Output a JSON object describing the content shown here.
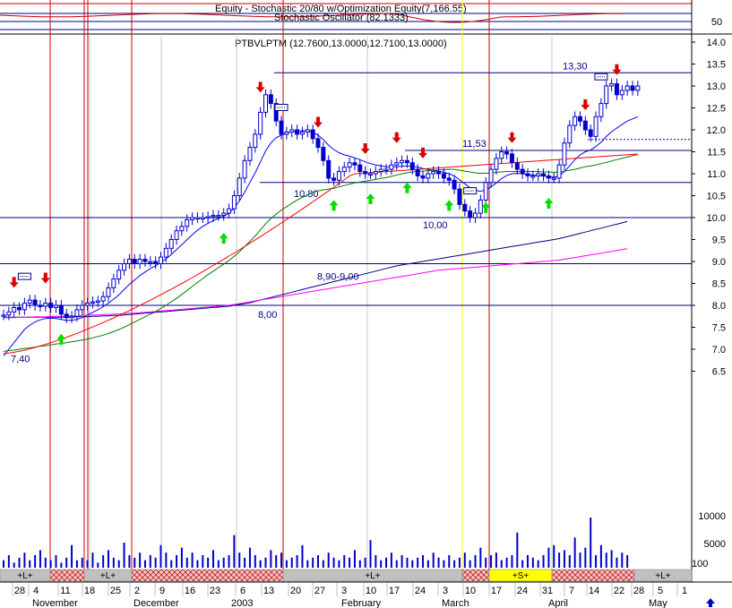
{
  "indicator": {
    "title": "Equity - Stochastic 20/80 w/Optimization Equity(7,166.55)",
    "subtitle": "Stochastic Oscillator (82.1333)",
    "level_label": "50"
  },
  "chart_data": {
    "type": "candlestick",
    "title": "PTBVLPTM (12.7600,13.0000,12.7100,13.0000)",
    "ylim": [
      5.8,
      14.0
    ],
    "y_ticks": [
      14.0,
      13.5,
      13.0,
      12.5,
      12.0,
      11.5,
      11.0,
      10.5,
      10.0,
      9.5,
      9.0,
      8.5,
      8.0,
      7.5,
      7.0,
      6.5
    ],
    "y_tick_labels": [
      "14.0",
      "13.5",
      "13.0",
      "12.5",
      "12.0",
      "11.5",
      "11.0",
      "10.5",
      "10.0",
      "9.5",
      "9.0",
      "8.5",
      "8.0",
      "7.5",
      "7.0",
      "6.5"
    ],
    "x_day_labels": [
      "28",
      "4",
      "11",
      "18",
      "25",
      "2",
      "9",
      "16",
      "23",
      "6",
      "13",
      "20",
      "27",
      "3",
      "10",
      "17",
      "24",
      "3",
      "10",
      "17",
      "24",
      "31",
      "7",
      "14",
      "22",
      "28",
      "5",
      "1"
    ],
    "x_month_labels": [
      "November",
      "December",
      "2003",
      "February",
      "March",
      "April",
      "May"
    ],
    "closes": [
      7.78,
      7.85,
      7.95,
      7.9,
      8.05,
      8.12,
      8.0,
      7.98,
      8.05,
      7.95,
      8.0,
      7.8,
      7.72,
      7.75,
      7.9,
      8.0,
      8.05,
      8.08,
      8.1,
      8.2,
      8.4,
      8.6,
      8.8,
      8.95,
      9.05,
      8.95,
      9.05,
      9.0,
      9.0,
      8.95,
      9.1,
      9.3,
      9.5,
      9.7,
      9.8,
      9.95,
      10.0,
      10.0,
      10.0,
      10.02,
      10.05,
      10.05,
      10.1,
      10.2,
      10.5,
      10.9,
      11.3,
      11.6,
      11.9,
      12.4,
      12.8,
      12.6,
      12.2,
      11.9,
      11.95,
      12.0,
      11.9,
      11.95,
      12.0,
      11.8,
      11.6,
      11.3,
      10.9,
      10.85,
      11.05,
      11.15,
      11.25,
      11.2,
      11.05,
      11.0,
      11.0,
      11.05,
      11.1,
      11.1,
      11.2,
      11.25,
      11.3,
      11.25,
      11.1,
      10.95,
      10.9,
      11.0,
      11.05,
      11.0,
      10.9,
      10.85,
      10.65,
      10.3,
      10.15,
      10.0,
      10.1,
      10.4,
      10.8,
      11.1,
      11.35,
      11.5,
      11.45,
      11.25,
      11.1,
      11.0,
      10.95,
      10.95,
      11.0,
      10.95,
      10.9,
      10.9,
      11.2,
      11.7,
      12.1,
      12.3,
      12.2,
      12.0,
      11.85,
      12.3,
      12.6,
      13.0,
      13.05,
      12.8,
      12.9,
      13.0,
      12.9,
      13.0
    ],
    "series": [
      {
        "name": "",
        "values": [
          6.85,
          7.0,
          7.15,
          7.3,
          7.45,
          7.55,
          7.62,
          7.67,
          7.7,
          7.71,
          7.7,
          7.68,
          7.66,
          7.66,
          7.68,
          7.72,
          7.78,
          7.84,
          7.9,
          7.97,
          8.05,
          8.14,
          8.24,
          8.36,
          8.48,
          8.58,
          8.68,
          8.76,
          8.84,
          8.9,
          8.98,
          9.06,
          9.16,
          9.27,
          9.38,
          9.5,
          9.61,
          9.71,
          9.8,
          9.87,
          9.93,
          9.98,
          10.03,
          10.1,
          10.22,
          10.38,
          10.58,
          10.8,
          11.02,
          11.27,
          11.52,
          11.7,
          11.82,
          11.88,
          11.92,
          11.96,
          11.97,
          11.98,
          11.98,
          11.95,
          11.88,
          11.78,
          11.65,
          11.55,
          11.48,
          11.43,
          11.4,
          11.36,
          11.32,
          11.27,
          11.23,
          11.2,
          11.18,
          11.16,
          11.16,
          11.16,
          11.17,
          11.18,
          11.17,
          11.15,
          11.12,
          11.1,
          11.08,
          11.06,
          11.03,
          11.0,
          10.95,
          10.86,
          10.77,
          10.68,
          10.62,
          10.6,
          10.63,
          10.7,
          10.79,
          10.89,
          10.96,
          11.0,
          11.01,
          11.0,
          10.99,
          10.97,
          10.96,
          10.95,
          10.93,
          10.92,
          10.95,
          11.05,
          11.18,
          11.32,
          11.43,
          11.5,
          11.54,
          11.62,
          11.72,
          11.85,
          11.96,
          12.04,
          12.12,
          12.2,
          12.25,
          12.3
        ]
      },
      {
        "name": "",
        "values": [
          6.95,
          6.97,
          6.98,
          7.0,
          7.02,
          7.03,
          7.05,
          7.07,
          7.08,
          7.1,
          7.12,
          7.13,
          7.15,
          7.17,
          7.19,
          7.21,
          7.23,
          7.26,
          7.29,
          7.32,
          7.36,
          7.4,
          7.45,
          7.5,
          7.56,
          7.62,
          7.68,
          7.74,
          7.8,
          7.86,
          7.93,
          8.0,
          8.08,
          8.16,
          8.25,
          8.34,
          8.43,
          8.52,
          8.61,
          8.7,
          8.78,
          8.86,
          8.94,
          9.02,
          9.12,
          9.22,
          9.34,
          9.46,
          9.58,
          9.72,
          9.86,
          9.98,
          10.08,
          10.17,
          10.25,
          10.33,
          10.4,
          10.46,
          10.52,
          10.57,
          10.61,
          10.63,
          10.65,
          10.67,
          10.7,
          10.73,
          10.76,
          10.79,
          10.81,
          10.83,
          10.85,
          10.87,
          10.89,
          10.91,
          10.94,
          10.97,
          11.0,
          11.02,
          11.04,
          11.05,
          11.06,
          11.07,
          11.08,
          11.09,
          11.09,
          11.1,
          11.1,
          11.08,
          11.06,
          11.04,
          11.02,
          11.01,
          11.01,
          11.02,
          11.03,
          11.04,
          11.05,
          11.05,
          11.05,
          11.05,
          11.05,
          11.05,
          11.05,
          11.04,
          11.04,
          11.03,
          11.04,
          11.06,
          11.08,
          11.1,
          11.13,
          11.16,
          11.18,
          11.2,
          11.23,
          11.26,
          11.29,
          11.32,
          11.35,
          11.38,
          11.41,
          11.44
        ]
      },
      {
        "name": "",
        "values": [
          7.73,
          7.73,
          7.73,
          7.73,
          7.73,
          7.73,
          7.73,
          7.73,
          7.73,
          7.73,
          7.73,
          7.73,
          7.73,
          7.73,
          7.74,
          7.74,
          7.74,
          7.75,
          7.75,
          7.76,
          7.76,
          7.77,
          7.77,
          7.78,
          7.79,
          7.8,
          7.81,
          7.82,
          7.83,
          7.84,
          7.85,
          7.86,
          7.87,
          7.88,
          7.89,
          7.9,
          7.91,
          7.92,
          7.93,
          7.94,
          7.95,
          7.96,
          7.97,
          7.98,
          8.0,
          8.02,
          8.04,
          8.06,
          8.09,
          8.12,
          8.15,
          8.18,
          8.21,
          8.24,
          8.27,
          8.3,
          8.33,
          8.36,
          8.39,
          8.42,
          8.45,
          8.48,
          8.51,
          8.54,
          8.57,
          8.6,
          8.63,
          8.66,
          8.69,
          8.72,
          8.75,
          8.78,
          8.81,
          8.84,
          8.87,
          8.9,
          8.92,
          8.94,
          8.96,
          8.98,
          9.0,
          9.02,
          9.04,
          9.06,
          9.08,
          9.1,
          9.12,
          9.14,
          9.16,
          9.18,
          9.2,
          9.22,
          9.24,
          9.26,
          9.28,
          9.3,
          9.32,
          9.34,
          9.36,
          9.38,
          9.4,
          9.42,
          9.44,
          9.46,
          9.48,
          9.5,
          9.52,
          9.55,
          9.58,
          9.61,
          9.64,
          9.67,
          9.7,
          9.73,
          9.76,
          9.79,
          9.82,
          9.85,
          9.88,
          9.91
        ]
      },
      {
        "name": "",
        "values": [
          7.72,
          7.72,
          7.72,
          7.73,
          7.73,
          7.73,
          7.74,
          7.74,
          7.74,
          7.75,
          7.75,
          7.75,
          7.76,
          7.76,
          7.76,
          7.77,
          7.77,
          7.78,
          7.78,
          7.79,
          7.79,
          7.8,
          7.8,
          7.81,
          7.82,
          7.82,
          7.83,
          7.84,
          7.85,
          7.86,
          7.87,
          7.88,
          7.89,
          7.9,
          7.91,
          7.92,
          7.93,
          7.94,
          7.95,
          7.96,
          7.97,
          7.98,
          7.99,
          8.0,
          8.02,
          8.04,
          8.06,
          8.08,
          8.1,
          8.12,
          8.14,
          8.16,
          8.18,
          8.2,
          8.22,
          8.24,
          8.26,
          8.28,
          8.3,
          8.32,
          8.34,
          8.36,
          8.38,
          8.4,
          8.42,
          8.44,
          8.46,
          8.48,
          8.5,
          8.52,
          8.54,
          8.56,
          8.58,
          8.6,
          8.62,
          8.64,
          8.66,
          8.68,
          8.7,
          8.72,
          8.74,
          8.76,
          8.78,
          8.8,
          8.81,
          8.82,
          8.83,
          8.84,
          8.85,
          8.86,
          8.87,
          8.88,
          8.89,
          8.9,
          8.91,
          8.92,
          8.93,
          8.94,
          8.95,
          8.96,
          8.97,
          8.98,
          8.99,
          9.0,
          9.01,
          9.02,
          9.03,
          9.05,
          9.07,
          9.09,
          9.11,
          9.13,
          9.15,
          9.17,
          9.19,
          9.21,
          9.23,
          9.25,
          9.27,
          9.29
        ]
      }
    ],
    "horizontal_levels": [
      {
        "value": 13.3,
        "label": "13,30"
      },
      {
        "value": 11.53,
        "label": "11,53"
      },
      {
        "value": 10.8,
        "label": "10.80"
      },
      {
        "value": 10.0,
        "label": "10,00"
      },
      {
        "value": 8.95,
        "label": "8,90-9,00"
      },
      {
        "value": 8.0,
        "label": "8,00"
      },
      {
        "value": 7.4,
        "label": "7,40"
      }
    ],
    "buy_signal_bars": [
      11,
      42,
      63,
      70,
      77,
      85,
      92,
      104
    ],
    "sell_signal_bars": [
      2,
      8,
      49,
      60,
      69,
      75,
      80,
      97,
      111,
      117
    ],
    "exit_marker_bars": [
      4,
      53,
      89,
      114
    ],
    "volume_labels": [
      "10000",
      "5000"
    ],
    "volume_scale": "100",
    "volumes": [
      0.3,
      0.5,
      0.2,
      0.4,
      0.6,
      0.3,
      0.5,
      0.7,
      0.4,
      0.3,
      0.5,
      0.2,
      0.4,
      0.9,
      0.3,
      0.4,
      0.3,
      0.6,
      0.2,
      0.5,
      0.7,
      0.4,
      0.3,
      1.0,
      0.5,
      0.4,
      0.6,
      0.3,
      0.5,
      0.4,
      0.9,
      0.6,
      0.3,
      0.5,
      0.8,
      0.4,
      0.6,
      0.3,
      0.5,
      0.4,
      0.7,
      0.3,
      0.4,
      0.5,
      1.3,
      0.6,
      0.4,
      0.8,
      0.5,
      0.3,
      0.4,
      0.7,
      0.5,
      0.6,
      0.3,
      0.4,
      0.5,
      0.9,
      0.3,
      0.4,
      0.5,
      0.3,
      0.6,
      0.4,
      0.3,
      0.5,
      0.4,
      0.7,
      0.3,
      0.4,
      1.1,
      0.5,
      0.3,
      0.4,
      0.6,
      0.3,
      0.5,
      0.4,
      0.3,
      0.4,
      0.5,
      0.3,
      0.6,
      0.4,
      0.3,
      0.5,
      0.3,
      0.4,
      0.6,
      0.3,
      0.5,
      0.8,
      0.4,
      0.5,
      0.6,
      0.3,
      0.4,
      0.5,
      1.4,
      0.3,
      0.5,
      0.4,
      0.3,
      0.5,
      0.8,
      0.9,
      0.6,
      0.7,
      0.5,
      1.2,
      0.6,
      0.8,
      2.0,
      0.5,
      0.9,
      0.6,
      0.7,
      0.4,
      0.6,
      0.5
    ],
    "strip_segments": [
      {
        "label": "+L+",
        "type": "long"
      },
      {
        "label": "",
        "type": "flat"
      },
      {
        "label": "+L+",
        "type": "long"
      },
      {
        "label": "",
        "type": "flat"
      },
      {
        "label": "+L+",
        "type": "long"
      },
      {
        "label": "",
        "type": "flat"
      },
      {
        "label": "+S+",
        "type": "short"
      },
      {
        "label": "",
        "type": "flat"
      },
      {
        "label": "+L+",
        "type": "long"
      }
    ]
  },
  "colors": {
    "price_candle": "#0000cc",
    "sma_short": "#0000ff",
    "sma_medium": "#008000",
    "sma_long": "#ff0000",
    "sma_xlong": "#000080",
    "sma_xxlong": "#ff00ff",
    "level_line": "#000080",
    "buy_arrow": "#00dd00",
    "sell_arrow": "#dd0000",
    "signal_line": "#cc0000",
    "short_signal_line": "#ffff00",
    "long_strip": "#c0c0c0",
    "flat_strip": "#e6a0a0",
    "short_strip": "#ffff00"
  }
}
